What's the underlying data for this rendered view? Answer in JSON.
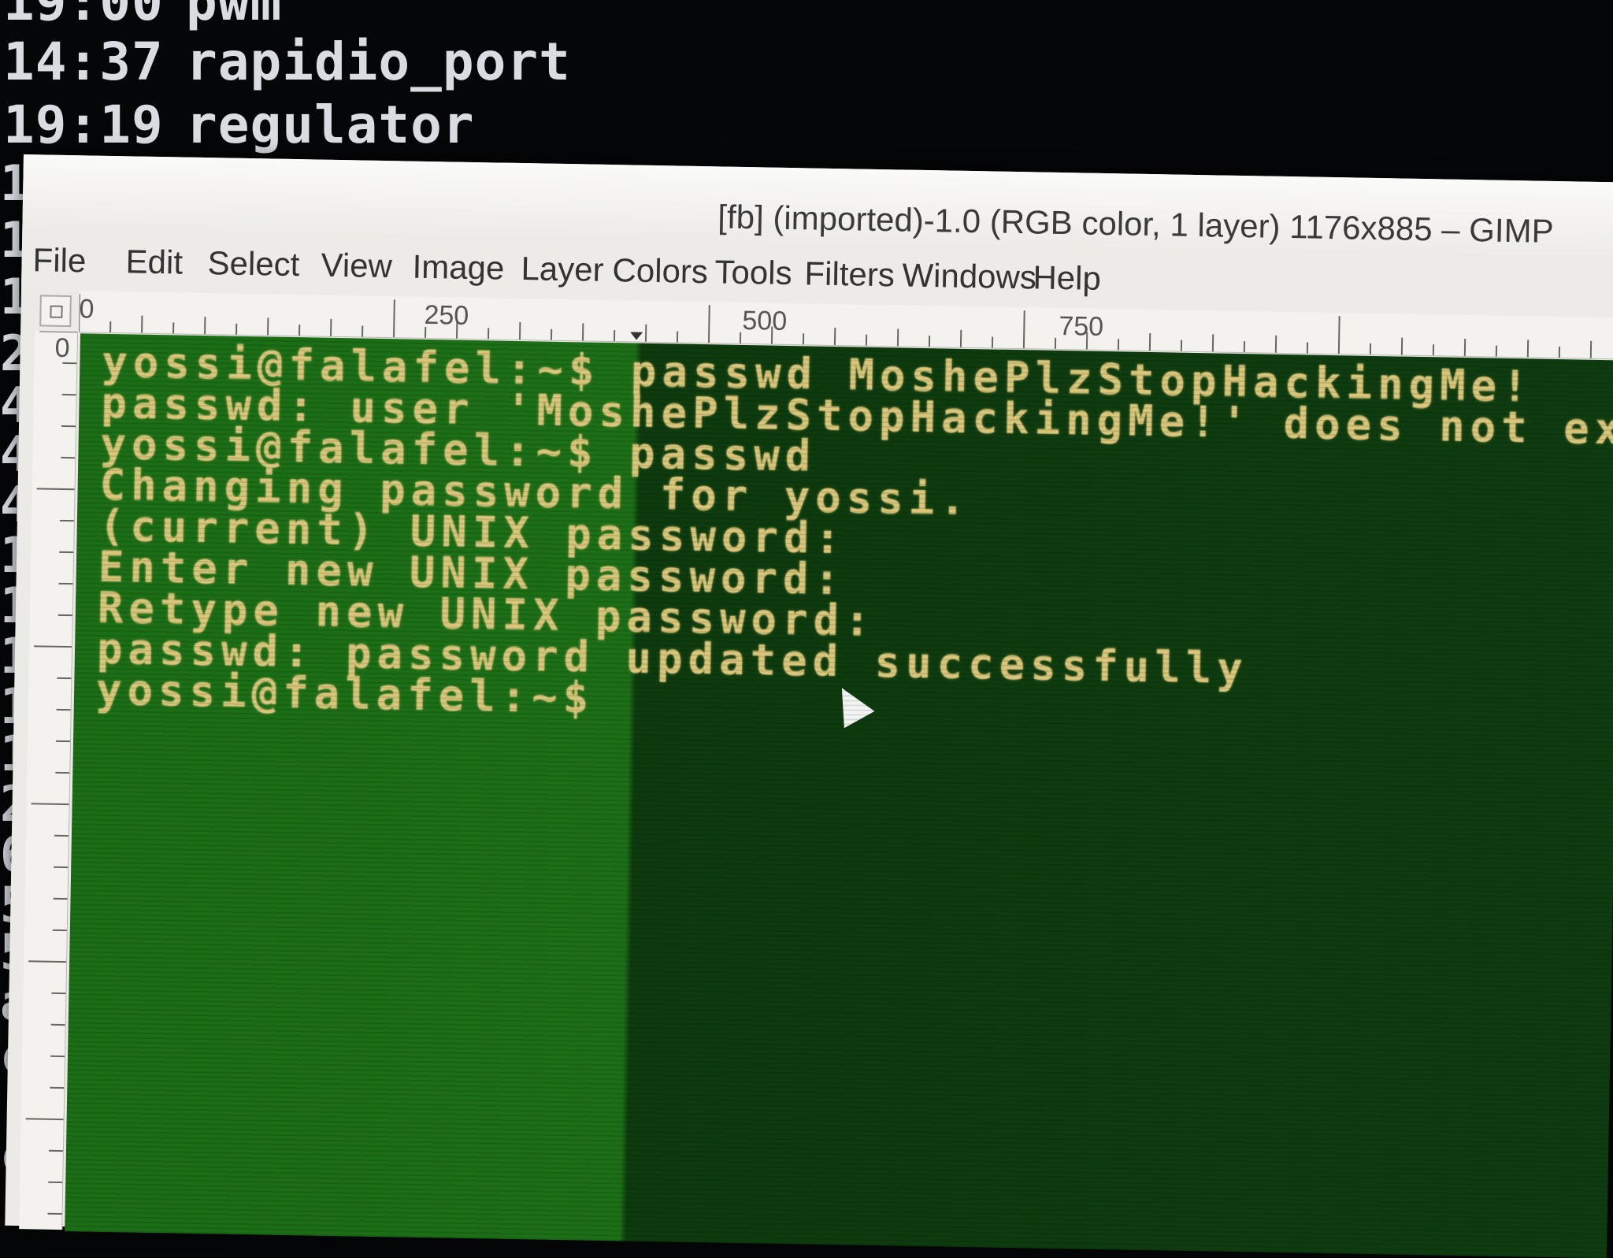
{
  "background_terminal": {
    "lines": [
      {
        "time": "19:00",
        "name": "pwm"
      },
      {
        "time": "14:37",
        "name": "rapidio_port"
      },
      {
        "time": "19:19",
        "name": "regulator"
      }
    ],
    "edge_fragments": [
      "1",
      "1",
      "1",
      "2",
      "4",
      "4",
      "4",
      "1",
      "1",
      "1",
      "1",
      "1",
      "2",
      "6",
      "5",
      "5",
      "aph",
      "css",
      "css"
    ]
  },
  "gimp": {
    "title": "[fb] (imported)-1.0 (RGB color, 1 layer) 1176x885 – GIMP",
    "menu": [
      "File",
      "Edit",
      "Select",
      "View",
      "Image",
      "Layer",
      "Colors",
      "Tools",
      "Filters",
      "Windows",
      "Help"
    ],
    "ruler_labels": [
      "0",
      "250",
      "500",
      "750"
    ],
    "vertical_ruler_label": "0"
  },
  "framebuffer_terminal": {
    "lines": [
      "yossi@falafel:~$ passwd MoshePlzStopHackingMe!",
      "passwd: user 'MoshePlzStopHackingMe!' does not exist",
      "yossi@falafel:~$ passwd",
      "Changing password for yossi.",
      "(current) UNIX password:",
      "Enter new UNIX password:",
      "Retype new UNIX password:",
      "passwd: password updated successfully",
      "yossi@falafel:~$"
    ]
  }
}
